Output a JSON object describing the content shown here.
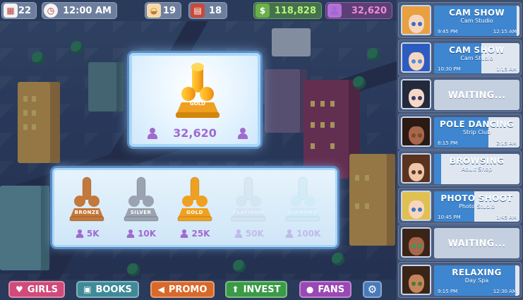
{
  "topbar": {
    "calendar": {
      "icon": "calendar-icon",
      "value": "22"
    },
    "clock": {
      "icon": "clock-icon",
      "value": "12:00 AM"
    },
    "stat_a": {
      "icon": "food-bowl-icon",
      "value": "19"
    },
    "stat_b": {
      "icon": "book-icon",
      "value": "18"
    },
    "money": {
      "icon": "money-bag-icon",
      "value": "118,828"
    },
    "fans": {
      "icon": "person-icon",
      "value": "32,620"
    }
  },
  "trophy_card": {
    "badge": "GOLD",
    "count": "32,620"
  },
  "tiers": [
    {
      "badge": "BRONZE",
      "req": "5K",
      "color": "#c4783a",
      "locked": false
    },
    {
      "badge": "SILVER",
      "req": "10K",
      "color": "#9aa3b0",
      "locked": false
    },
    {
      "badge": "GOLD",
      "req": "25K",
      "color": "#f0a020",
      "locked": false
    },
    {
      "badge": "PLATINUM",
      "req": "50K",
      "color": "#c9d7e6",
      "locked": true
    },
    {
      "badge": "DIAMOND",
      "req": "100K",
      "color": "#bfe6f2",
      "locked": true
    }
  ],
  "nav": {
    "girls": "GIRLS",
    "books": "BOOKS",
    "promo": "PROMO",
    "invest": "INVEST",
    "fans": "FANS"
  },
  "colors": {
    "girls": "#d04a7a",
    "books": "#3f8a98",
    "promo": "#d9692a",
    "invest": "#3a9a46",
    "fans": "#9a48b5",
    "settings": "#4a7ab8"
  },
  "girls": [
    {
      "title": "CAM SHOW",
      "sub": "Cam Studio",
      "start": "9:45 PM",
      "end": "12:15 AM",
      "progress": 0.97,
      "waiting": false,
      "hair": "#e8a040",
      "skin": "#f7d6c0",
      "eyes": "#3a6ec0"
    },
    {
      "title": "CAM SHOW",
      "sub": "Cam Studio",
      "start": "10:30 PM",
      "end": "1:15 AM",
      "progress": 0.55,
      "waiting": false,
      "hair": "#2d5cc0",
      "skin": "#f7d6c0",
      "eyes": "#4a90e0"
    },
    {
      "title": "WAITING...",
      "sub": "",
      "start": "",
      "end": "",
      "progress": 0,
      "waiting": true,
      "hair": "#222a3c",
      "skin": "#f5d8c8",
      "eyes": "#3a3a6a"
    },
    {
      "title": "POLE DANCING",
      "sub": "Strip Club",
      "start": "8:15 PM",
      "end": "2:15 AM",
      "progress": 0.64,
      "waiting": false,
      "hair": "#2b1a14",
      "skin": "#a8664a",
      "eyes": "#7a4a2a"
    },
    {
      "title": "BROWSING",
      "sub": "Adult Shop",
      "start": "",
      "end": "",
      "progress": 0.08,
      "waiting": false,
      "hair": "#5a3320",
      "skin": "#f0c6a8",
      "eyes": "#5a3a2a"
    },
    {
      "title": "PHOTO SHOOT",
      "sub": "Photo Studio",
      "start": "10:45 PM",
      "end": "1:45 AM",
      "progress": 0.47,
      "waiting": false,
      "hair": "#e0c050",
      "skin": "#f7d6c0",
      "eyes": "#3a7ac0"
    },
    {
      "title": "WAITING...",
      "sub": "",
      "start": "",
      "end": "",
      "progress": 0,
      "waiting": true,
      "hair": "#3a2418",
      "skin": "#a8664a",
      "eyes": "#3a9a5a"
    },
    {
      "title": "RELAXING",
      "sub": "Day Spa",
      "start": "9:15 PM",
      "end": "12:30 AM",
      "progress": 0.95,
      "waiting": false,
      "hair": "#3a2418",
      "skin": "#c7845a",
      "eyes": "#4a7a3a"
    }
  ]
}
